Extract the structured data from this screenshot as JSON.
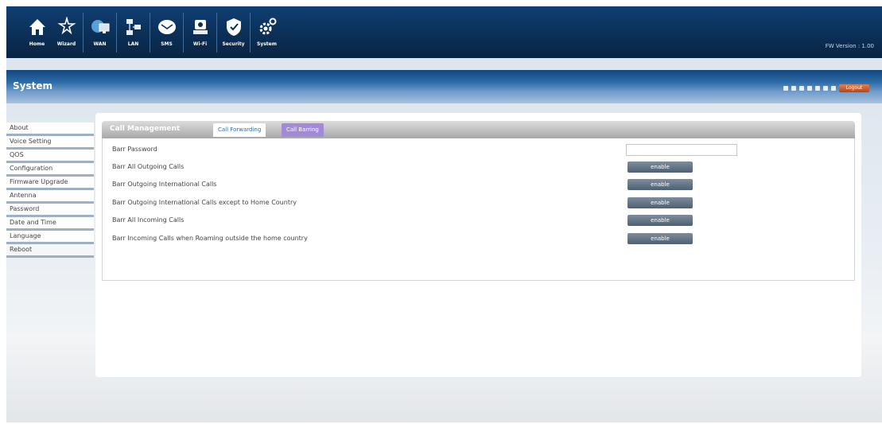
{
  "topnav": {
    "items": [
      {
        "label": "Home",
        "icon": "home-icon"
      },
      {
        "label": "Wizard",
        "icon": "wizard-icon"
      },
      {
        "label": "WAN",
        "icon": "wan-icon"
      },
      {
        "label": "LAN",
        "icon": "lan-icon"
      },
      {
        "label": "SMS",
        "icon": "sms-icon"
      },
      {
        "label": "Wi-Fi",
        "icon": "wifi-icon"
      },
      {
        "label": "Security",
        "icon": "shield-icon"
      },
      {
        "label": "System",
        "icon": "gear-icon"
      }
    ],
    "fw_version": "FW Version : 1.00"
  },
  "header": {
    "section_title": "System",
    "logout_label": "Logout"
  },
  "sidebar": {
    "items": [
      "About",
      "Voice Setting",
      "QOS",
      "Configuration",
      "Firmware Upgrade",
      "Antenna",
      "Password",
      "Date and Time",
      "Language",
      "Reboot"
    ]
  },
  "panel": {
    "title": "Call Management",
    "tabs": [
      "Call Forwarding",
      "Call Barring"
    ],
    "rows": [
      {
        "label": "Barr Password",
        "type": "input",
        "value": ""
      },
      {
        "label": "Barr All Outgoing Calls",
        "type": "button",
        "value": "enable"
      },
      {
        "label": "Barr Outgoing International Calls",
        "type": "button",
        "value": "enable"
      },
      {
        "label": "Barr Outgoing International Calls except to Home Country",
        "type": "button",
        "value": "enable"
      },
      {
        "label": "Barr All Incoming Calls",
        "type": "button",
        "value": "enable"
      },
      {
        "label": "Barr Incoming Calls when Roaming outside the home country",
        "type": "button",
        "value": "enable"
      }
    ]
  },
  "colors": {
    "topbar": "#0b2f57",
    "tab_active": "#a18ad6",
    "button": "#5b6b7c",
    "logout": "#c9582a"
  }
}
